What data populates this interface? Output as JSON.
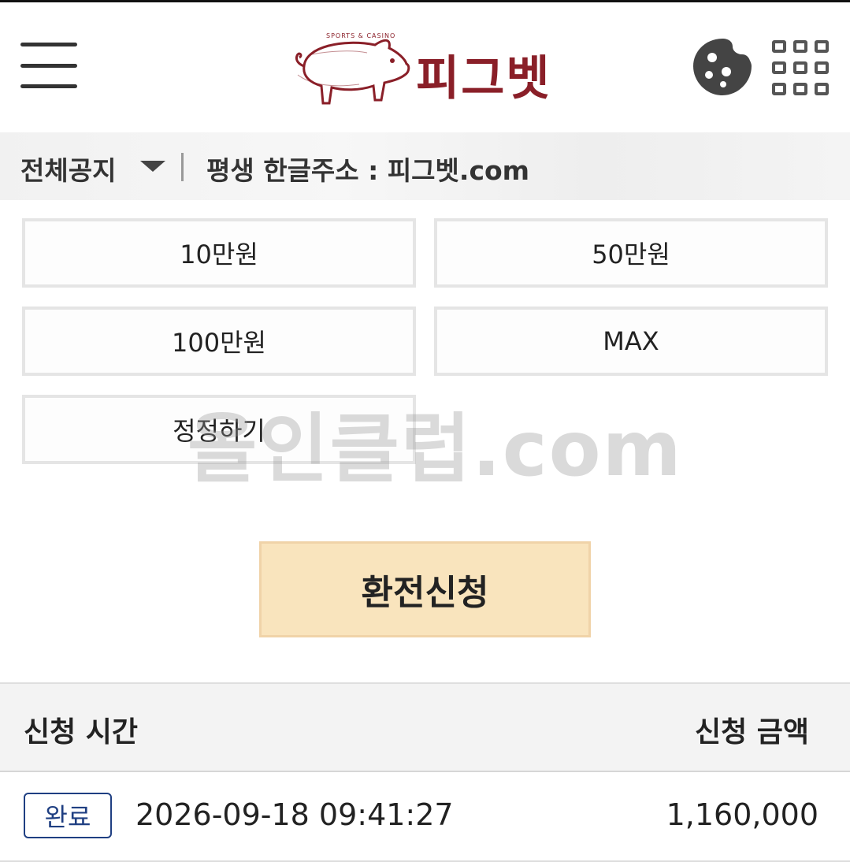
{
  "header": {
    "menu_icon": "hamburger-menu-icon",
    "logo_text": "피그벳",
    "logo_subtext": "SPORTS & CASINO",
    "cookie_icon": "cookie-icon",
    "apps_icon": "app-grid-icon",
    "brand_color": "#8a1f28"
  },
  "notice": {
    "label": "전체공지",
    "text": "평생 한글주소 : 피그벳.com"
  },
  "amounts": {
    "btn_10": "10만원",
    "btn_50": "50만원",
    "btn_100": "100만원",
    "btn_max": "MAX",
    "btn_reset": "정정하기"
  },
  "watermark": "올인클럽.com",
  "exchange_button": "환전신청",
  "table": {
    "col_time": "신청 시간",
    "col_amount": "신청 금액",
    "rows": [
      {
        "status": "완료",
        "time": "2026-09-18 09:41:27",
        "amount": "1,160,000"
      }
    ]
  },
  "colors": {
    "exchange_bg": "#f9e4bd",
    "badge": "#1f3f82"
  }
}
